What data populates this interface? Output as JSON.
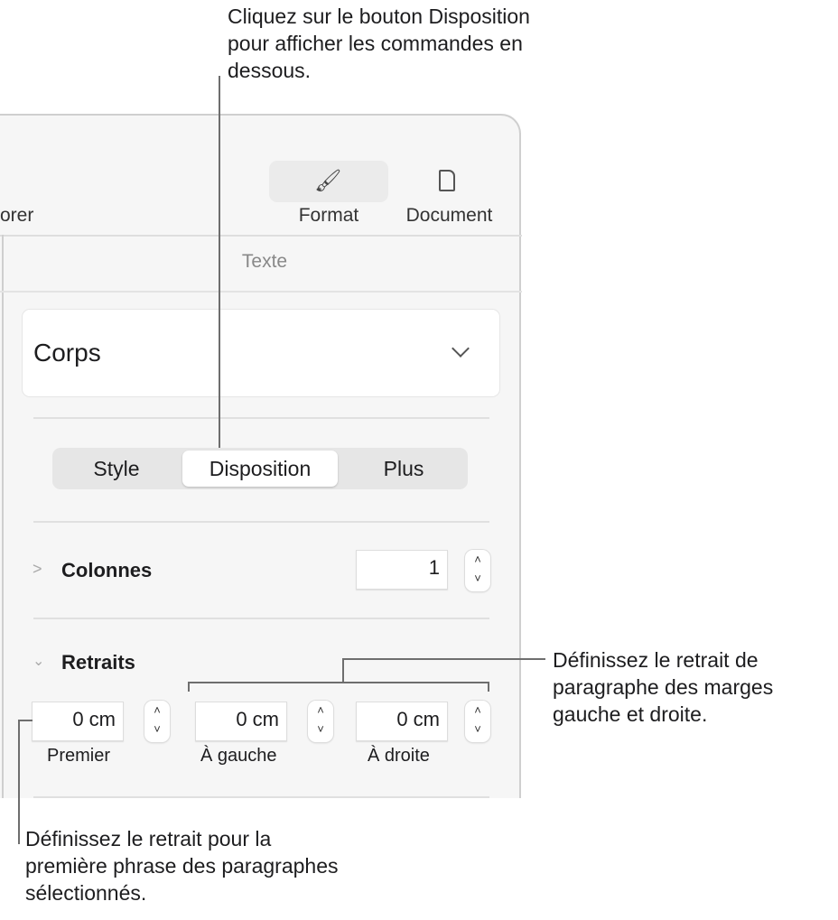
{
  "callouts": {
    "top": "Cliquez sur le bouton Disposition pour afficher les commandes en dessous.",
    "right": "Définissez le retrait de paragraphe des marges gauche et droite.",
    "bottom": "Définissez le retrait pour la première phrase des paragraphes sélectionnés."
  },
  "toolbar": {
    "partial_label": "orer",
    "format": "Format",
    "document": "Document",
    "format_icon": "paintbrush-icon",
    "document_icon": "document-icon"
  },
  "section_title": "Texte",
  "style_select": {
    "value": "Corps"
  },
  "segments": [
    "Style",
    "Disposition",
    "Plus"
  ],
  "selected_segment": "Disposition",
  "columns": {
    "label": "Colonnes",
    "value": "1"
  },
  "indents": {
    "label": "Retraits",
    "fields": [
      {
        "value": "0 cm",
        "label": "Premier"
      },
      {
        "value": "0 cm",
        "label": "À gauche"
      },
      {
        "value": "0 cm",
        "label": "À droite"
      }
    ]
  },
  "colors": {
    "panel": "#f6f6f6",
    "selected_tab_bg": "#ebebeb"
  }
}
